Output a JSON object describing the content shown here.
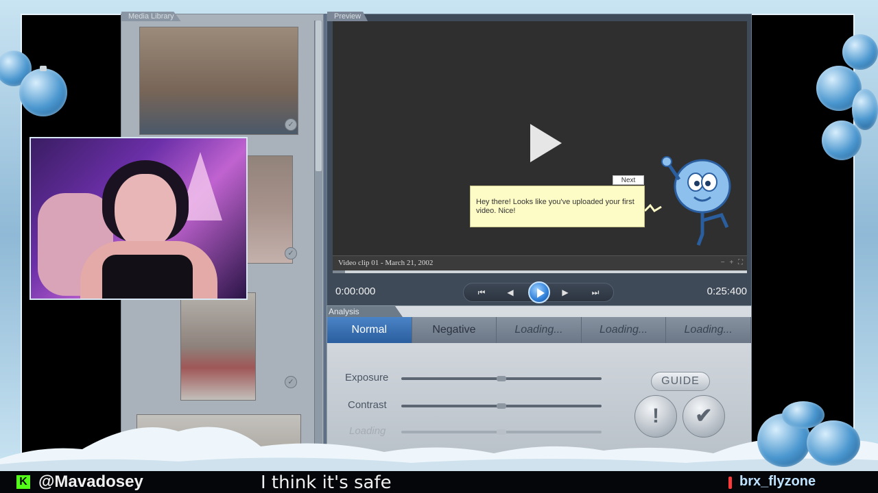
{
  "media_library": {
    "tab_label": "Media Library"
  },
  "preview": {
    "tab_label": "Preview",
    "clip_title": "Video clip 01 - March 21, 2002",
    "zoom_controls": "− + ⛶",
    "current_time": "0:00:000",
    "total_time": "0:25:400",
    "seek_progress_percent": 3,
    "transport": {
      "skip_back": "⏮",
      "step_back": "◀",
      "step_forward": "▶",
      "skip_forward": "⏭"
    }
  },
  "tooltip": {
    "next_label": "Next",
    "message": "Hey there! Looks like you've uploaded your first video. Nice!"
  },
  "analysis": {
    "tab_label": "Analysis",
    "modes": [
      {
        "label": "Normal",
        "state": "active"
      },
      {
        "label": "Negative",
        "state": "normal"
      },
      {
        "label": "Loading...",
        "state": "loading"
      },
      {
        "label": "Loading...",
        "state": "loading"
      },
      {
        "label": "Loading...",
        "state": "loading"
      }
    ],
    "sliders": [
      {
        "label": "Exposure",
        "value_percent": 50
      },
      {
        "label": "Contrast",
        "value_percent": 50
      },
      {
        "label": "Loading",
        "value_percent": 50,
        "disabled": true
      }
    ],
    "guide_label": "GUIDE",
    "alert_label": "!",
    "confirm_label": "✔"
  },
  "stream": {
    "handle": "@Mavadosey",
    "ticker": "I think it's safe",
    "latest_follower": "brx_flyzone",
    "kick_icon": "K"
  },
  "colors": {
    "accent_blue": "#2a5e9e",
    "tooltip_yellow": "#fdfcc6",
    "kick_green": "#53fc18"
  }
}
